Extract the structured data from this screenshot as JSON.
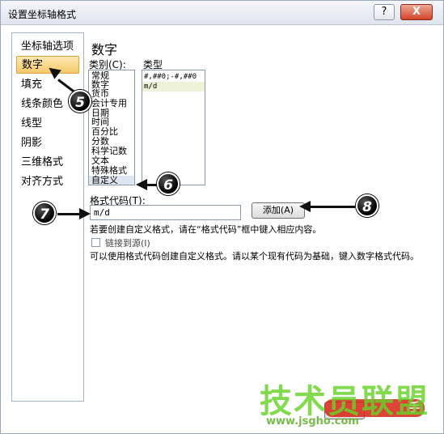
{
  "window": {
    "title": "设置坐标轴格式",
    "help_label": "?",
    "close_label": "X"
  },
  "sidebar": {
    "items": [
      {
        "label": "坐标轴选项"
      },
      {
        "label": "数字"
      },
      {
        "label": "填充"
      },
      {
        "label": "线条颜色"
      },
      {
        "label": "线型"
      },
      {
        "label": "阴影"
      },
      {
        "label": "三维格式"
      },
      {
        "label": "对齐方式"
      }
    ],
    "selected": "数字"
  },
  "panel": {
    "title": "数字",
    "category_label": "类别(C):",
    "type_label": "类型",
    "categories": [
      "常规",
      "数字",
      "货币",
      "会计专用",
      "日期",
      "时间",
      "百分比",
      "分数",
      "科学记数",
      "文本",
      "特殊格式",
      "自定义"
    ],
    "selected_category": "自定义",
    "types": [
      "#,##0;-#,##0",
      "m/d"
    ],
    "selected_type": "m/d",
    "format_code_label": "格式代码(T):",
    "format_code_value": "m/d",
    "add_button_label": "添加(A)",
    "hint_text": "若要创建自定义格式，请在“格式代码”框中键入相应内容。",
    "link_source_label": "链接到源(I)",
    "link_source_checked": false,
    "description": "可以使用格式代码创建自定义格式。请以某个现有代码为基础，键入数字格式代码。"
  },
  "annotations": {
    "badges": [
      "5",
      "6",
      "7",
      "8"
    ]
  },
  "watermark": {
    "brand": "技术员联盟",
    "url": "www.jsgho.com",
    "tag": "手"
  }
}
